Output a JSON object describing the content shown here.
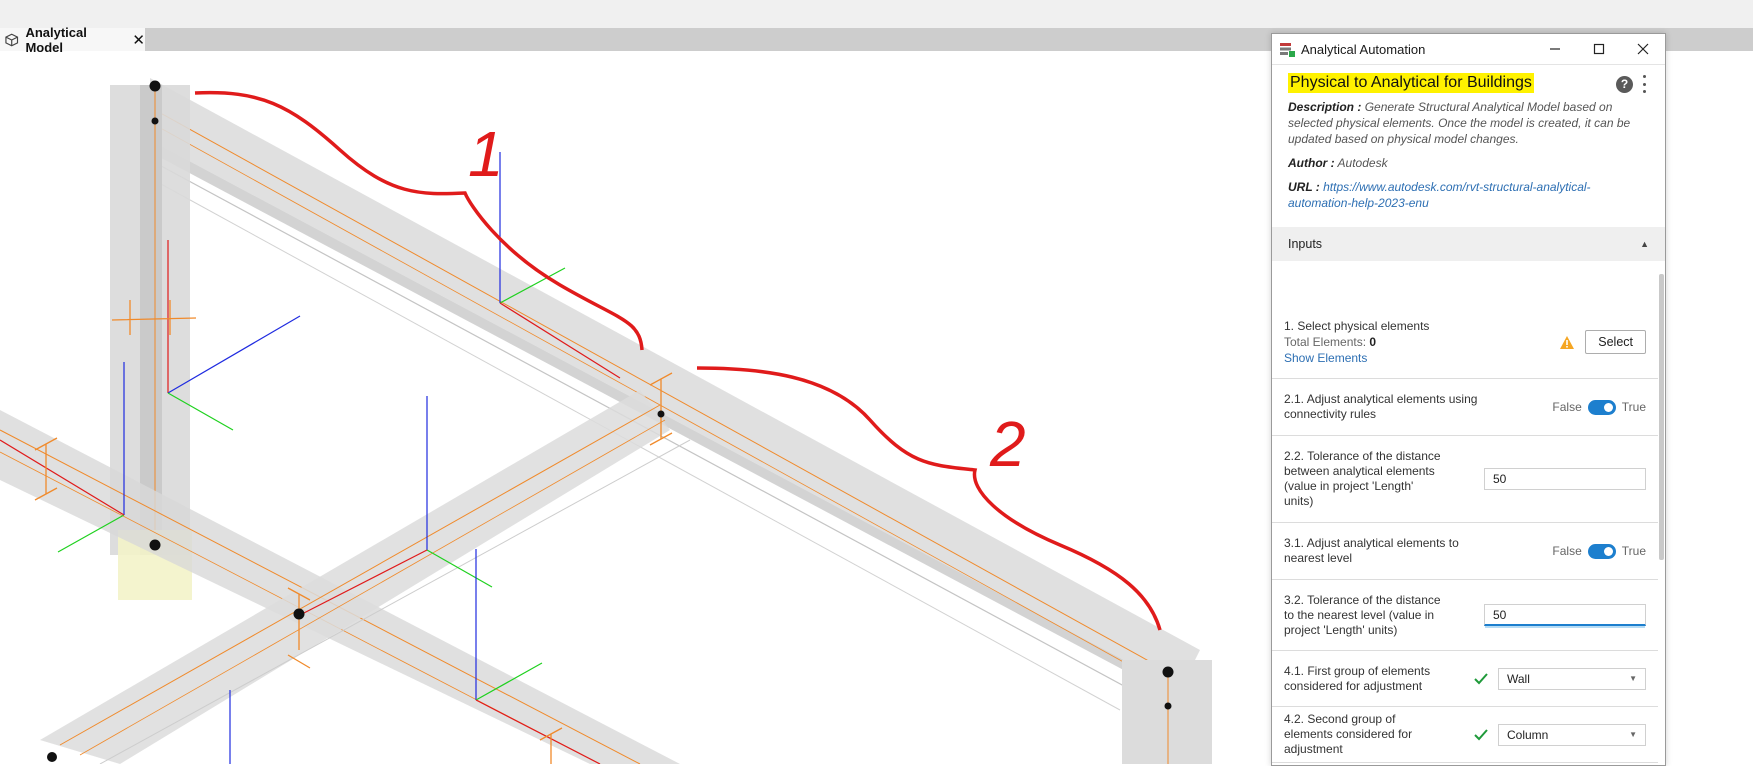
{
  "tab": {
    "label": "Analytical Model",
    "close": "✕"
  },
  "annotations": {
    "one": "1",
    "two": "2"
  },
  "panel": {
    "title": "Analytical Automation",
    "package_title": "Physical to Analytical for Buildings",
    "help": "?",
    "description_label": "Description :",
    "description": "Generate Structural Analytical Model based on selected physical elements. Once the model is created, it can be updated based on physical model changes.",
    "author_label": "Author :",
    "author": "Autodesk",
    "url_label": "URL :",
    "url": "https://www.autodesk.com/rvt-structural-analytical-automation-help-2023-enu",
    "inputs_label": "Inputs",
    "inputs_caret": "▲",
    "rows": {
      "select": {
        "label": "1. Select physical elements",
        "total_label": "Total Elements:",
        "total": "0",
        "show": "Show Elements",
        "button": "Select"
      },
      "r21": {
        "label": "2.1. Adjust analytical elements using connectivity rules",
        "false": "False",
        "true": "True"
      },
      "r22": {
        "label": "2.2. Tolerance of the distance between analytical elements (value in project 'Length' units)",
        "value": "50"
      },
      "r31": {
        "label": "3.1. Adjust analytical elements to nearest level",
        "false": "False",
        "true": "True"
      },
      "r32": {
        "label": "3.2. Tolerance of the distance to the nearest level (value in project 'Length' units)",
        "value": "50"
      },
      "r41": {
        "label": "4.1. First group of elements considered for adjustment",
        "value": "Wall",
        "arrow": "▼"
      },
      "r42": {
        "label": "4.2. Second group of elements considered for adjustment",
        "value": "Column",
        "arrow": "▼"
      }
    }
  },
  "colors": {
    "accent": "#1d7fce",
    "highlight": "#fff200",
    "annotation": "#e01b1b",
    "beam_center": "#f08a2b"
  }
}
